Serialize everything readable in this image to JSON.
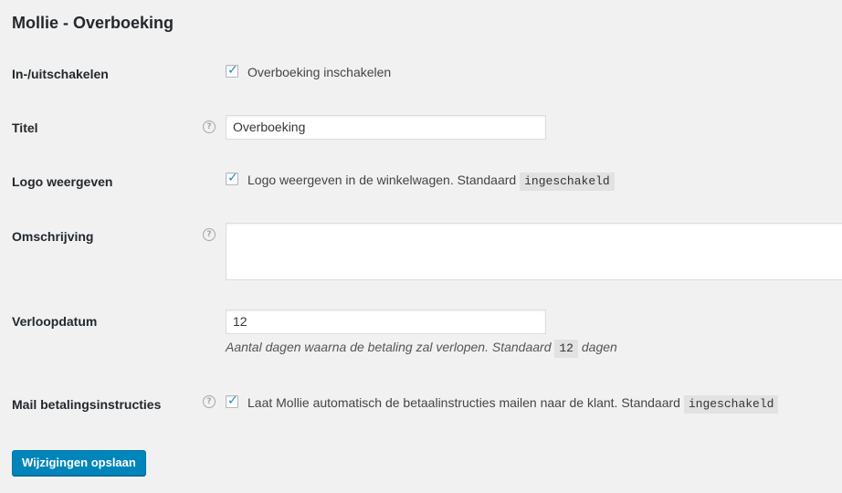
{
  "page": {
    "title": "Mollie - Overboeking"
  },
  "fields": {
    "enable": {
      "label": "In-/uitschakelen",
      "checkbox_checked": true,
      "checkbox_label": "Overboeking inschakelen"
    },
    "title": {
      "label": "Titel",
      "help_icon": "question-icon",
      "value": "Overboeking"
    },
    "show_logo": {
      "label": "Logo weergeven",
      "checkbox_checked": true,
      "checkbox_label": "Logo weergeven in de winkelwagen. Standaard",
      "default_code": "ingeschakeld"
    },
    "description": {
      "label": "Omschrijving",
      "help_icon": "question-icon",
      "value": ""
    },
    "expiry": {
      "label": "Verloopdatum",
      "value": "12",
      "hint_before": "Aantal dagen waarna de betaling zal verlopen. Standaard",
      "hint_code": "12",
      "hint_after": "dagen"
    },
    "mail_instructions": {
      "label": "Mail betalingsinstructies",
      "help_icon": "question-icon",
      "checkbox_checked": true,
      "checkbox_label": "Laat Mollie automatisch de betaalinstructies mailen naar de klant. Standaard",
      "default_code": "ingeschakeld"
    }
  },
  "actions": {
    "save_label": "Wijzigingen opslaan"
  },
  "colors": {
    "background": "#f1f1f1",
    "primary_button": "#0085ba",
    "checkmark": "#1e8cbe"
  }
}
